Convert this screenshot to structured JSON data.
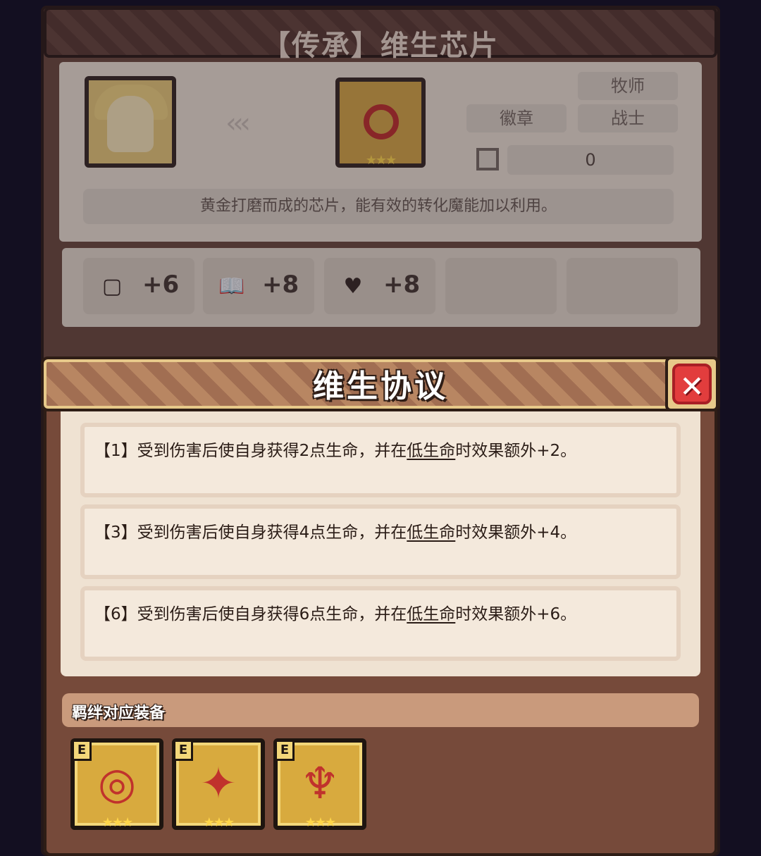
{
  "item": {
    "title": "【传承】维生芯片",
    "arrows": "‹‹‹",
    "tags": {
      "row1": [
        "牧师"
      ],
      "row2": [
        "徽章",
        "战士"
      ]
    },
    "score": "0",
    "description": "黄金打磨而成的芯片，能有效的转化魔能加以利用。",
    "chip_stars": "★★★",
    "stats": [
      {
        "icon": "shield-icon",
        "glyph": "▢",
        "value": "+6"
      },
      {
        "icon": "book-icon",
        "glyph": "📖",
        "value": "+8"
      },
      {
        "icon": "heart-icon",
        "glyph": "♥",
        "value": "+8"
      }
    ]
  },
  "popup": {
    "title": "维生协议",
    "close_glyph": "✕",
    "effects": [
      {
        "prefix": "【1】受到伤害后使自身获得2点生命，并在",
        "keyword": "低生命",
        "suffix": "时效果额外+2。"
      },
      {
        "prefix": "【3】受到伤害后使自身获得4点生命，并在",
        "keyword": "低生命",
        "suffix": "时效果额外+4。"
      },
      {
        "prefix": "【6】受到伤害后使自身获得6点生命，并在",
        "keyword": "低生命",
        "suffix": "时效果额外+6。"
      }
    ],
    "bond_label": "羁绊对应装备",
    "equipment": [
      {
        "icon": "chip-icon",
        "glyph": "◎",
        "badge": "E",
        "stars": "★★★"
      },
      {
        "icon": "armor-icon",
        "glyph": "✦",
        "badge": "E",
        "stars": "★★★"
      },
      {
        "icon": "beetle-icon",
        "glyph": "♆",
        "badge": "E",
        "stars": "★★★"
      }
    ]
  },
  "colors": {
    "accent": "#d8aa3e",
    "close": "#e23d3d",
    "panel": "#764a3a"
  }
}
